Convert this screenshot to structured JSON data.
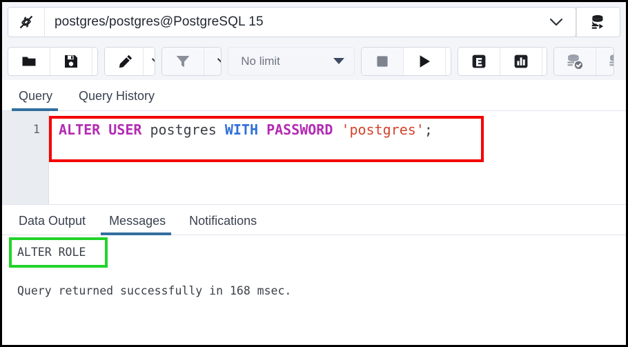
{
  "window": {
    "connection_icon": "plug-connection-icon",
    "title": "postgres/postgres@PostgreSQL 15",
    "chevron_icon": "chevron-down-icon",
    "database_icon": "database-connect-icon"
  },
  "toolbar": {
    "open_file": {
      "label": "",
      "icon": "open-folder-icon"
    },
    "save_file": {
      "label": "",
      "icon": "save-floppy-icon"
    },
    "save_dropdown": {
      "icon": "chevron-down-icon"
    },
    "edit": {
      "icon": "pencil-edit-icon"
    },
    "edit_dropdown": {
      "icon": "chevron-down-icon"
    },
    "filter": {
      "icon": "filter-funnel-icon",
      "disabled": true
    },
    "filter_dropdown": {
      "icon": "chevron-down-icon"
    },
    "row_limit": {
      "value": "No limit",
      "icon": "triangle-down-icon"
    },
    "stop": {
      "icon": "stop-square-icon",
      "disabled": true
    },
    "execute": {
      "icon": "play-triangle-icon"
    },
    "execute_dropdown": {
      "icon": "chevron-down-icon"
    },
    "explain": {
      "icon": "explain-e-icon",
      "label": "E"
    },
    "explain_analyze": {
      "icon": "bar-chart-icon"
    },
    "explain_dropdown": {
      "icon": "chevron-down-icon"
    },
    "commit": {
      "icon": "database-commit-icon",
      "disabled": true
    },
    "rollback": {
      "icon": "database-rollback-icon",
      "disabled": true
    }
  },
  "upper_tabs": [
    {
      "label": "Query",
      "active": true
    },
    {
      "label": "Query History",
      "active": false
    }
  ],
  "editor": {
    "line_number": "1",
    "tokens": [
      {
        "text": "ALTER USER",
        "type": "keyword"
      },
      {
        "text": " ",
        "type": "plain"
      },
      {
        "text": "postgres",
        "type": "identifier"
      },
      {
        "text": " ",
        "type": "plain"
      },
      {
        "text": "WITH",
        "type": "keyword2"
      },
      {
        "text": " ",
        "type": "plain"
      },
      {
        "text": "PASSWORD",
        "type": "keyword"
      },
      {
        "text": " ",
        "type": "plain"
      },
      {
        "text": "'postgres'",
        "type": "string"
      },
      {
        "text": ";",
        "type": "punctuation"
      }
    ],
    "full_text": "ALTER USER postgres WITH PASSWORD 'postgres';"
  },
  "lower_tabs": [
    {
      "label": "Data Output",
      "active": false
    },
    {
      "label": "Messages",
      "active": true
    },
    {
      "label": "Notifications",
      "active": false
    }
  ],
  "messages": {
    "result": "ALTER ROLE",
    "status": "Query returned successfully in 168 msec."
  },
  "annotations": {
    "sql_highlight_color": "#f40000",
    "result_highlight_color": "#22d32a"
  },
  "colors": {
    "keyword": "#b32bb3",
    "keyword2": "#2f6fd8",
    "string": "#d1442b",
    "identifier": "#3b3f46",
    "tab_active_underline": "#336f9e",
    "toolbar_bg": "#f3f5f9",
    "gutter_bg": "#e9ecf0"
  }
}
